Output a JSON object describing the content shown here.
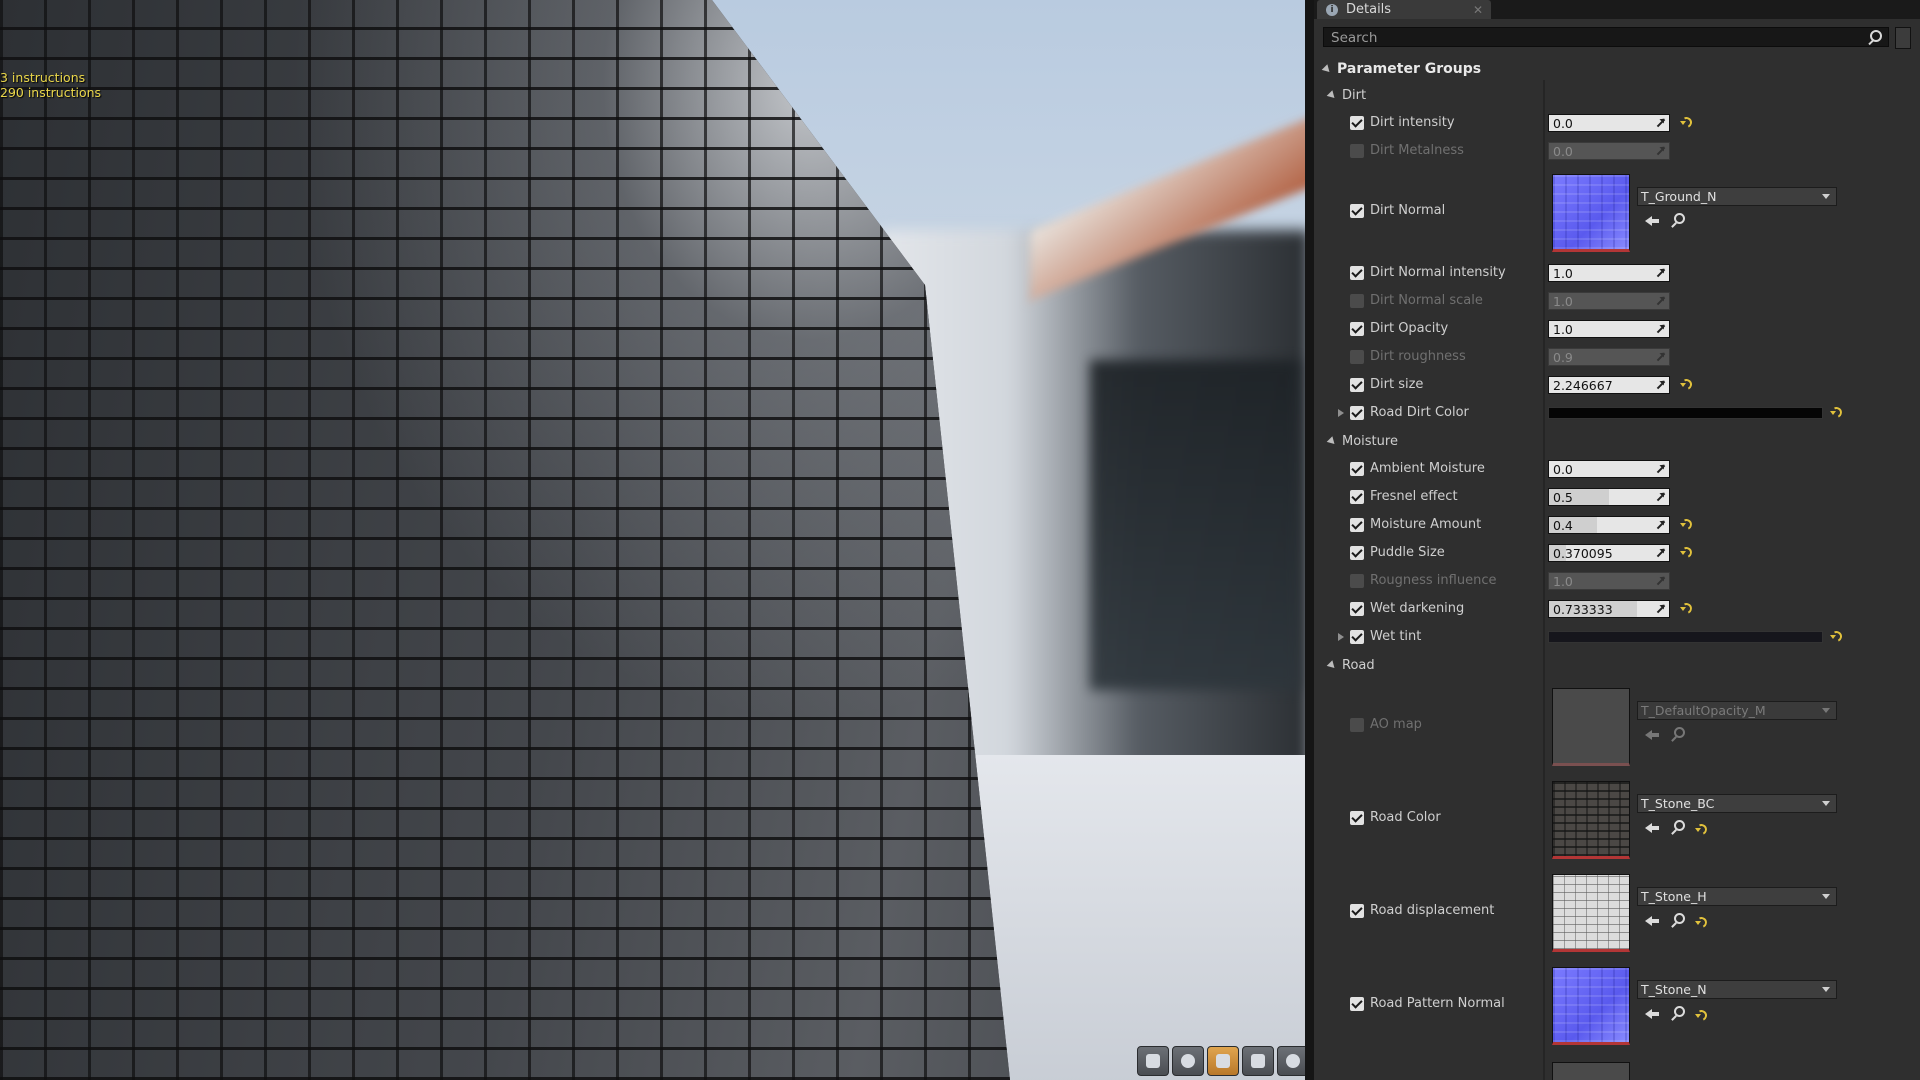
{
  "viewport": {
    "stats": [
      "3 instructions",
      "290 instructions"
    ],
    "toolbar": [
      "cylinder-icon",
      "sphere-icon",
      "plane-icon",
      "cube-icon",
      "mesh-icon"
    ]
  },
  "details": {
    "tab_title": "Details",
    "search_placeholder": "Search",
    "parameter_groups_label": "Parameter Groups",
    "groups": {
      "dirt": {
        "label": "Dirt",
        "dirt_intensity": {
          "label": "Dirt intensity",
          "value": "0.0"
        },
        "dirt_metalness": {
          "label": "Dirt Metalness",
          "value": "0.0"
        },
        "dirt_normal": {
          "label": "Dirt Normal",
          "asset": "T_Ground_N"
        },
        "dirt_normal_intensity": {
          "label": "Dirt Normal intensity",
          "value": "1.0"
        },
        "dirt_normal_scale": {
          "label": "Dirt Normal scale",
          "value": "1.0"
        },
        "dirt_opacity": {
          "label": "Dirt Opacity",
          "value": "1.0"
        },
        "dirt_roughness": {
          "label": "Dirt roughness",
          "value": "0.9"
        },
        "dirt_size": {
          "label": "Dirt size",
          "value": "2.246667"
        },
        "road_dirt_color": {
          "label": "Road Dirt Color"
        }
      },
      "moisture": {
        "label": "Moisture",
        "ambient_moisture": {
          "label": "Ambient Moisture",
          "value": "0.0"
        },
        "fresnel_effect": {
          "label": "Fresnel effect",
          "value": "0.5"
        },
        "moisture_amount": {
          "label": "Moisture Amount",
          "value": "0.4"
        },
        "puddle_size": {
          "label": "Puddle Size",
          "value": "0.370095"
        },
        "rougness_influence": {
          "label": "Rougness influence",
          "value": "1.0"
        },
        "wet_darkening": {
          "label": "Wet darkening",
          "value": "0.733333"
        },
        "wet_tint": {
          "label": "Wet tint"
        }
      },
      "road": {
        "label": "Road",
        "ao_map": {
          "label": "AO map",
          "asset": "T_DefaultOpacity_M"
        },
        "road_color": {
          "label": "Road Color",
          "asset": "T_Stone_BC"
        },
        "road_displacement": {
          "label": "Road displacement",
          "asset": "T_Stone_H"
        },
        "road_pattern_normal": {
          "label": "Road Pattern Normal",
          "asset": "T_Stone_N"
        }
      }
    }
  },
  "colors": {
    "panel_bg": "#2f2f2f",
    "reset_arrow": "#e2c23c",
    "stats_text": "#e9d64a"
  }
}
